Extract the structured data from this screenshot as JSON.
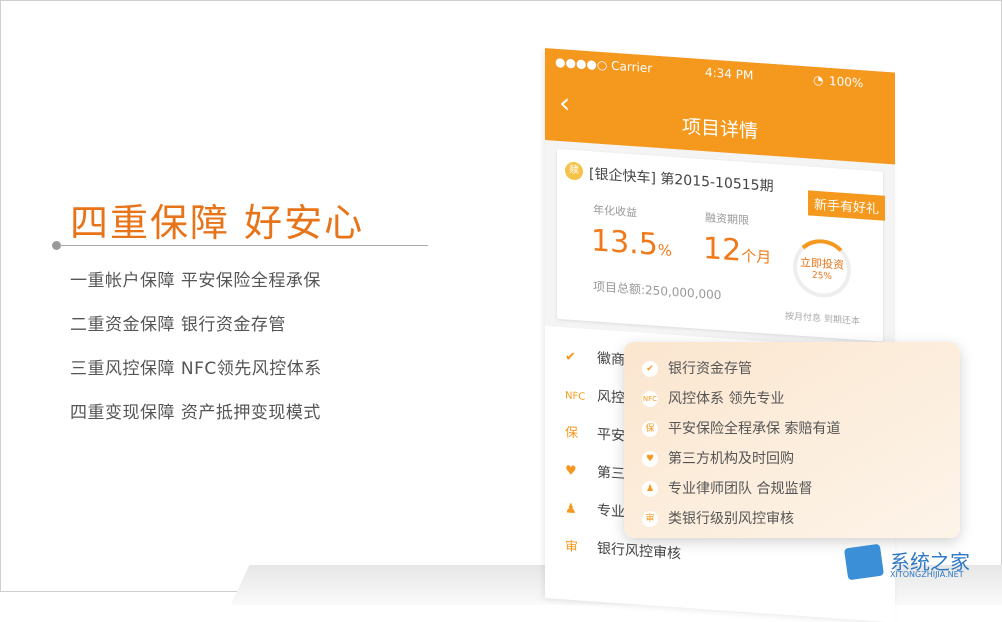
{
  "heading": "四重保障  好安心",
  "features": [
    "一重帐户保障  平安保险全程承保",
    "二重资金保障  银行资金存管",
    "三重风控保障  NFC领先风控体系",
    "四重变现保障  资产抵押变现模式"
  ],
  "phone": {
    "status": {
      "carrier": "●●●●○ Carrier",
      "time": "4:34 PM",
      "battery": "100%"
    },
    "nav_title": "项目详情",
    "card": {
      "icon_text": "赎",
      "title": "[银企快车] 第2015-10515期",
      "ribbon": "新手有好礼",
      "rate_label": "年化收益",
      "rate_value": "13.5",
      "rate_unit": "%",
      "term_label": "融资期限",
      "term_value": "12",
      "term_unit": "个月",
      "total": "项目总额:250,000,000",
      "invest_button": "立即投资",
      "invest_percent": "25%",
      "note": "按月付息  到期还本"
    },
    "list": [
      {
        "icon": "✔",
        "label": "徽商"
      },
      {
        "icon": "NFC",
        "label": "风控"
      },
      {
        "icon": "保",
        "label": "平安"
      },
      {
        "icon": "♥",
        "label": "第三"
      },
      {
        "icon": "♟",
        "label": "专业"
      },
      {
        "icon": "审",
        "label": "银行风控审核"
      }
    ]
  },
  "popup": [
    {
      "icon": "✔",
      "label": "银行资金存管"
    },
    {
      "icon": "NFC",
      "label": "风控体系  领先专业"
    },
    {
      "icon": "保",
      "label": "平安保险全程承保 索赔有道"
    },
    {
      "icon": "♥",
      "label": "第三方机构及时回购"
    },
    {
      "icon": "♟",
      "label": "专业律师团队 合规监督"
    },
    {
      "icon": "审",
      "label": "类银行级别风控审核"
    }
  ],
  "watermark": {
    "text": "系统之家",
    "url": "XITONGZHIJIA.NET"
  },
  "colors": {
    "accent": "#f5981e",
    "heading": "#e8741a"
  }
}
